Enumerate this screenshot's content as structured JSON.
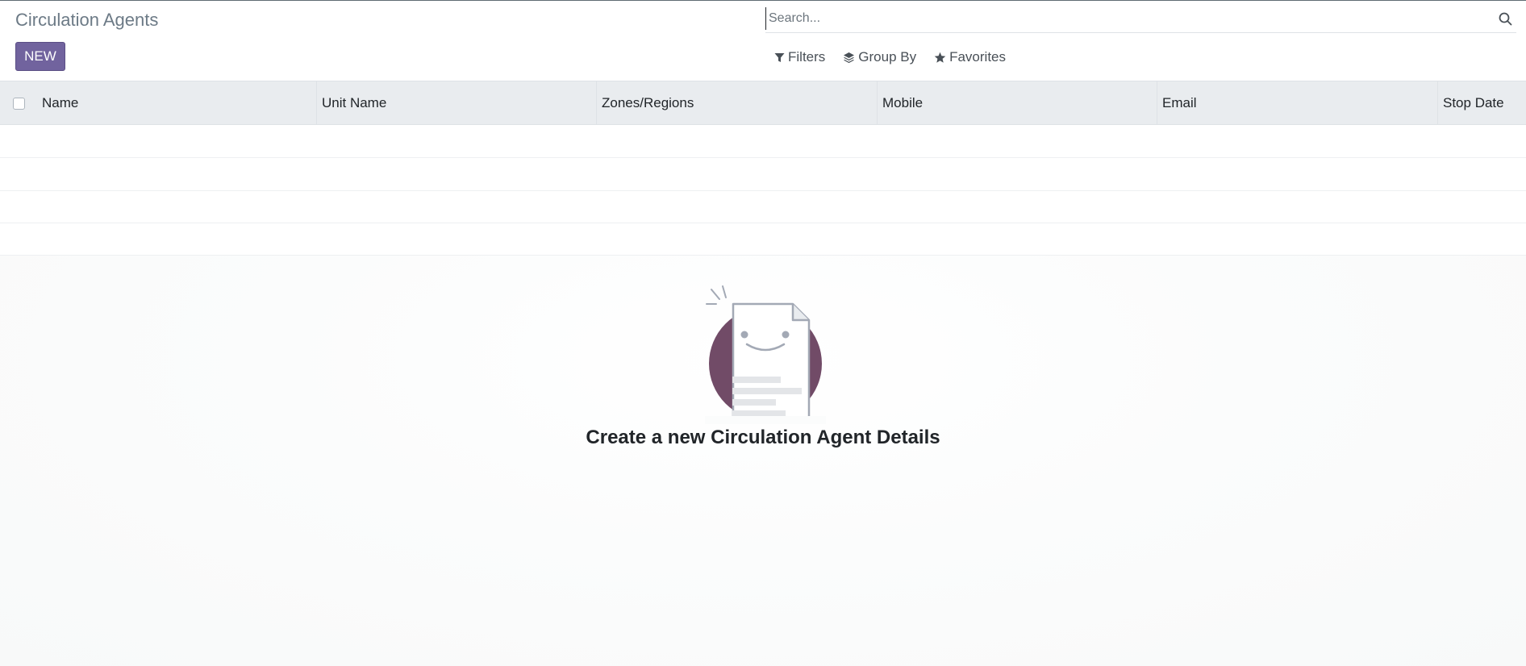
{
  "control_panel": {
    "title": "Circulation Agents",
    "new_button_label": "NEW",
    "search": {
      "value": "",
      "placeholder": "Search..."
    },
    "facets": [
      {
        "label": "Filters",
        "icon": "filter-icon"
      },
      {
        "label": "Group By",
        "icon": "layers-icon"
      },
      {
        "label": "Favorites",
        "icon": "star-icon"
      }
    ]
  },
  "list": {
    "columns": [
      "Name",
      "Unit Name",
      "Zones/Regions",
      "Mobile",
      "Email",
      "Stop Date"
    ],
    "rows": []
  },
  "empty_state": {
    "title": "Create a new Circulation Agent Details",
    "illustration": "smiling-document-icon"
  },
  "colors": {
    "primary": "#71639e",
    "header_bg": "#e9ecef",
    "illustration_circle": "#714b67",
    "title_gray": "#6c7a86"
  }
}
